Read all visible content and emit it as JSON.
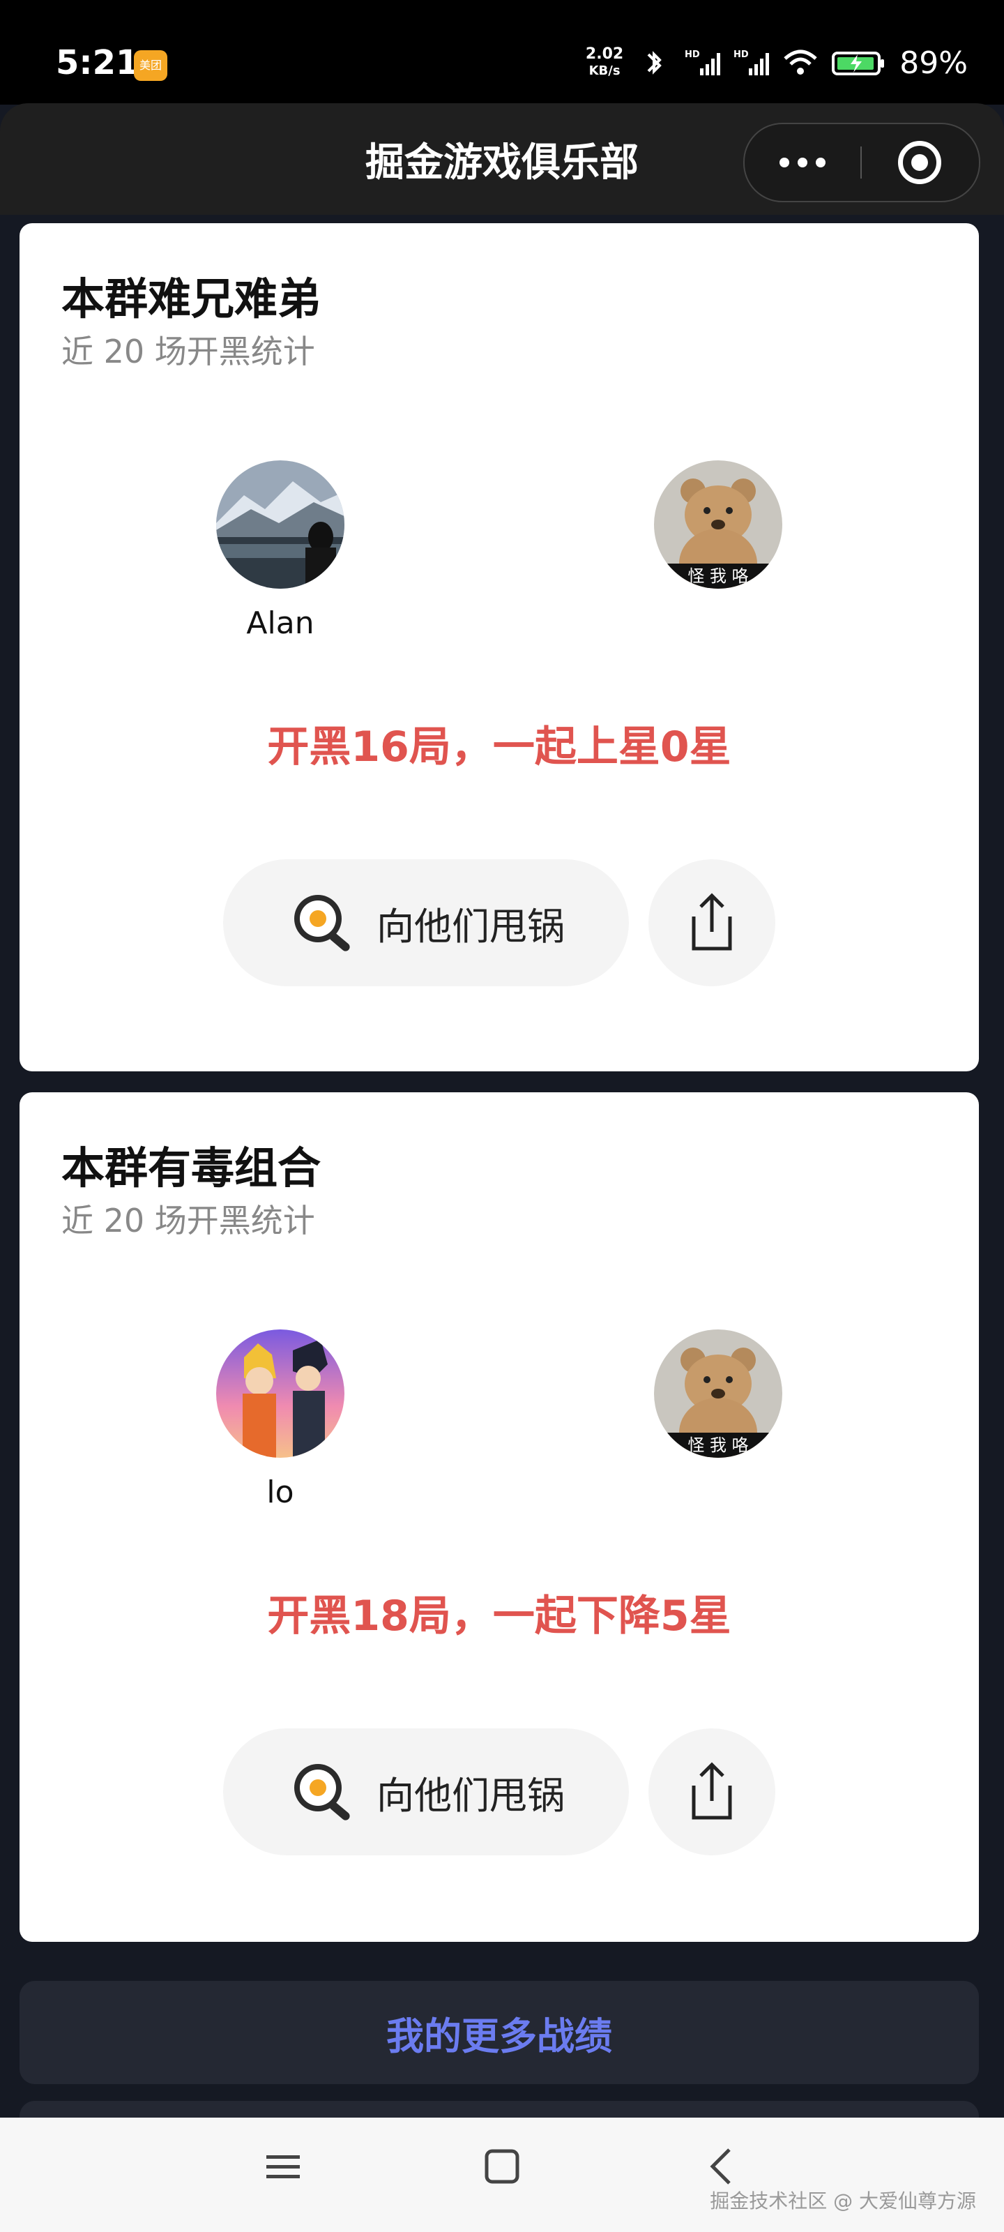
{
  "status_bar": {
    "time": "5:21",
    "app_badge": "美团",
    "net_speed": "2.02",
    "net_unit": "KB/s",
    "battery": "89%"
  },
  "nav": {
    "title": "掘金游戏俱乐部"
  },
  "cards": [
    {
      "title": "本群难兄难弟",
      "subtitle": "近 20 场开黑统计",
      "players": [
        {
          "name": "Alan",
          "avatar": "mountain-lake-avatar"
        },
        {
          "name": "",
          "avatar": "teddy-bear-avatar",
          "caption": "怪 我 咯"
        }
      ],
      "stat": "开黑16局，一起上星0星",
      "blame_label": "向他们甩锅",
      "blame_icon": "frying-pan-egg-icon",
      "share_icon": "share-icon"
    },
    {
      "title": "本群有毒组合",
      "subtitle": "近 20 场开黑统计",
      "players": [
        {
          "name": "lo",
          "avatar": "anime-duo-avatar"
        },
        {
          "name": "",
          "avatar": "teddy-bear-avatar",
          "caption": "怪 我 咯"
        }
      ],
      "stat": "开黑18局，一起下降5星",
      "blame_label": "向他们甩锅",
      "blame_icon": "frying-pan-egg-icon",
      "share_icon": "share-icon"
    }
  ],
  "more_button": "我的更多战绩",
  "watermark": "掘金技术社区 @ 大爱仙尊方源",
  "colors": {
    "accent_red": "#e0544f",
    "link_blue": "#6b7cf0",
    "page_bg": "#151923"
  }
}
